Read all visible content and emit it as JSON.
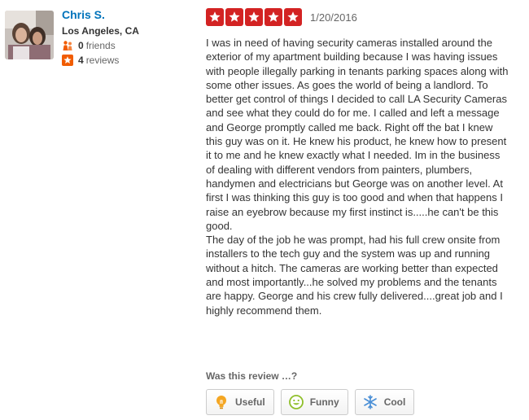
{
  "user": {
    "name": "Chris S.",
    "location": "Los Angeles, CA",
    "friends_count": "0",
    "friends_label": "friends",
    "reviews_count": "4",
    "reviews_label": "reviews"
  },
  "review": {
    "rating": 5,
    "max_rating": 5,
    "date": "1/20/2016",
    "text": "I was in need of having security cameras installed around the exterior of my apartment building because I was having issues with people illegally parking in tenants parking spaces along with some other issues.  As goes the world of being a landlord.  To better get control of things I decided to call LA Security Cameras and see what they could do for me.  I called and left a message and George promptly called me back.   Right off the bat I knew this guy was on it.   He knew his product, he knew how to present it to me and he knew exactly what I needed.  Im in the business of dealing with different vendors from painters, plumbers, handymen and electricians but George was on another level.  At first I was thinking this guy is too good and when that happens I raise an eyebrow because my first instinct is.....he can't be this good.\nThe day of the job he was prompt, had his full crew onsite from installers to the tech guy and the system was up and running without a hitch.   The cameras are working better than expected and most importantly...he solved my problems and the tenants are happy.  George and his crew fully delivered....great job and I highly recommend them."
  },
  "feedback": {
    "question": "Was this review …?",
    "buttons": {
      "useful": "Useful",
      "funny": "Funny",
      "cool": "Cool"
    }
  },
  "colors": {
    "star_red": "#d32323",
    "link_blue": "#0073bb",
    "friends_orange": "#f15c00"
  },
  "icons": [
    "friends-icon",
    "review-star-icon",
    "lightbulb-icon",
    "smiley-icon",
    "snowflake-icon"
  ]
}
